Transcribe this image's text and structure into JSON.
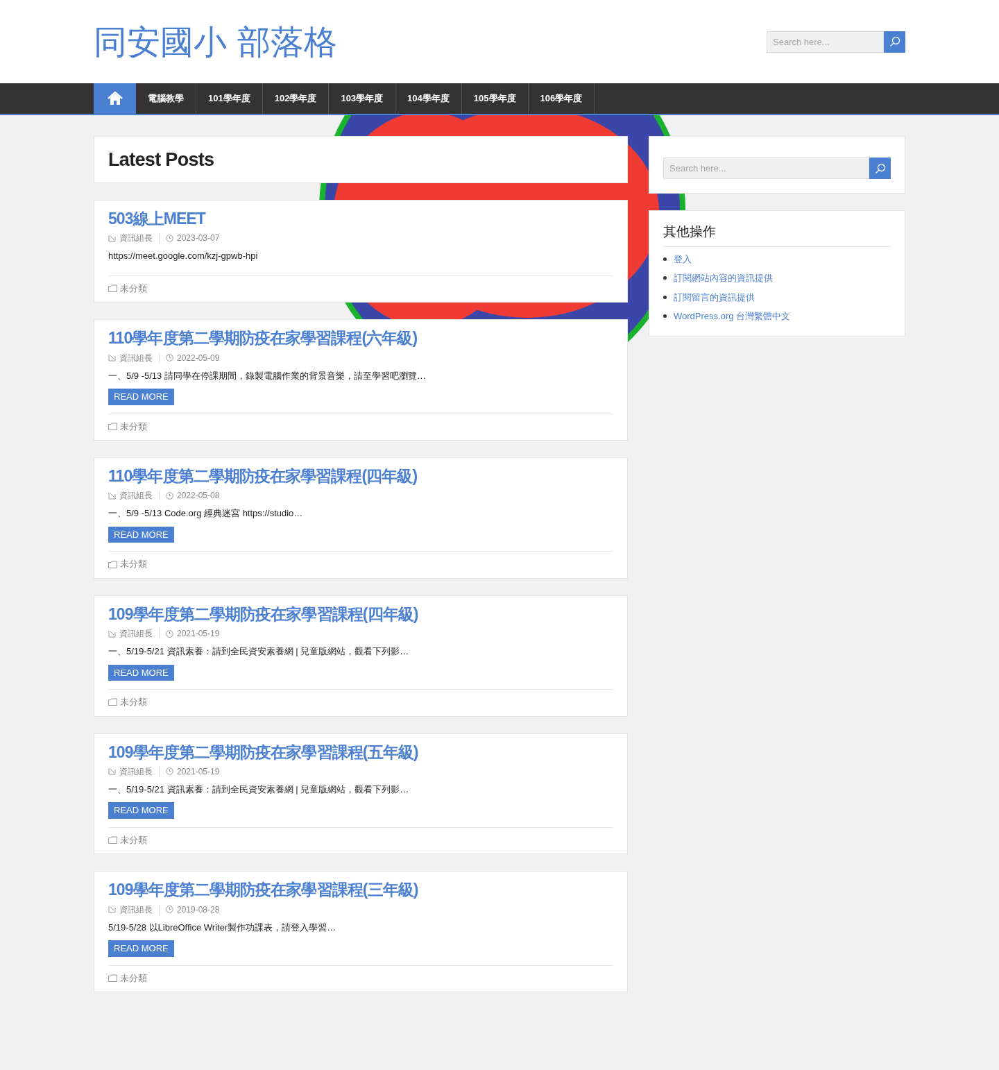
{
  "site_title": "同安國小 部落格",
  "header_search": {
    "placeholder": "Search here..."
  },
  "nav": [
    {
      "kind": "home",
      "selected": true
    },
    {
      "label": "電腦教學",
      "selected": false
    },
    {
      "label": "101學年度",
      "selected": false
    },
    {
      "label": "102學年度",
      "selected": false
    },
    {
      "label": "103學年度",
      "selected": false
    },
    {
      "label": "104學年度",
      "selected": false
    },
    {
      "label": "105學年度",
      "selected": false
    },
    {
      "label": "106學年度",
      "selected": false
    }
  ],
  "page_heading": "Latest Posts",
  "posts": [
    {
      "title": "503線上MEET",
      "author": "資訊組長",
      "date": "2023-03-07",
      "excerpt": "https://meet.google.com/kzj-gpwb-hpi",
      "category": "未分類"
    },
    {
      "title": "110學年度第二學期防疫在家學習課程(六年級)",
      "author": "資訊組長",
      "date": "2022-05-09",
      "excerpt": "一、5/9 -5/13 請同學在停課期間，錄製電腦作業的背景音樂，請至學習吧瀏覽…",
      "read_more": "READ MORE",
      "category": "未分類"
    },
    {
      "title": "110學年度第二學期防疫在家學習課程(四年級)",
      "author": "資訊組長",
      "date": "2022-05-08",
      "excerpt": "一、5/9 -5/13 Code.org 經典迷宮 https://studio…",
      "read_more": "READ MORE",
      "category": "未分類"
    },
    {
      "title": "109學年度第二學期防疫在家學習課程(四年級)",
      "author": "資訊組長",
      "date": "2021-05-19",
      "excerpt": "一、5/19-5/21 資訊素養：請到全民資安素養網 | 兒童版網站，觀看下列影…",
      "read_more": "READ MORE",
      "category": "未分類"
    },
    {
      "title": "109學年度第二學期防疫在家學習課程(五年級)",
      "author": "資訊組長",
      "date": "2021-05-19",
      "excerpt": "一、5/19-5/21 資訊素養：請到全民資安素養網 | 兒童版網站，觀看下列影…",
      "read_more": "READ MORE",
      "category": "未分類"
    },
    {
      "title": "109學年度第二學期防疫在家學習課程(三年級)",
      "author": "資訊組長",
      "date": "2019-08-28",
      "excerpt": "5/19-5/28 以LibreOffice Writer製作功課表，請登入學習…",
      "read_more": "READ MORE",
      "category": "未分類"
    }
  ],
  "sidebar": {
    "search": {
      "placeholder": "Search here..."
    },
    "widget": {
      "title": "其他操作",
      "links": [
        "登入",
        "訂閱網站內容的資訊提供",
        "訂閱留言的資訊提供",
        "WordPress.org 台灣繁體中文"
      ]
    }
  }
}
